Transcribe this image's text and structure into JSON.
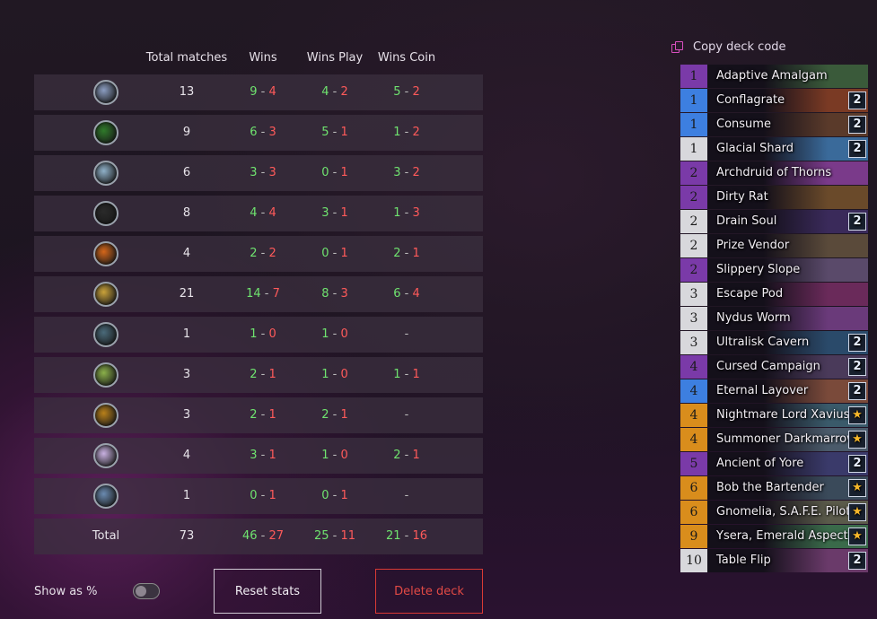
{
  "stats": {
    "headers": {
      "total": "Total matches",
      "wins": "Wins",
      "wins_play": "Wins Play",
      "wins_coin": "Wins Coin"
    },
    "rows": [
      {
        "icon": "rogue-class-icon",
        "total": "13",
        "wins_w": "9",
        "wins_l": "4",
        "play_w": "4",
        "play_l": "2",
        "coin_w": "5",
        "coin_l": "2"
      },
      {
        "icon": "demon-hunter-class-icon",
        "total": "9",
        "wins_w": "6",
        "wins_l": "3",
        "play_w": "5",
        "play_l": "1",
        "coin_w": "1",
        "coin_l": "2"
      },
      {
        "icon": "mage-class-icon",
        "total": "6",
        "wins_w": "3",
        "wins_l": "3",
        "play_w": "0",
        "play_l": "1",
        "coin_w": "3",
        "coin_l": "2"
      },
      {
        "icon": "death-knight-class-icon",
        "total": "8",
        "wins_w": "4",
        "wins_l": "4",
        "play_w": "3",
        "play_l": "1",
        "coin_w": "1",
        "coin_l": "3"
      },
      {
        "icon": "warrior-class-icon",
        "total": "4",
        "wins_w": "2",
        "wins_l": "2",
        "play_w": "0",
        "play_l": "1",
        "coin_w": "2",
        "coin_l": "1"
      },
      {
        "icon": "paladin-class-icon",
        "total": "21",
        "wins_w": "14",
        "wins_l": "7",
        "play_w": "8",
        "play_l": "3",
        "coin_w": "6",
        "coin_l": "4"
      },
      {
        "icon": "shaman-class-icon",
        "total": "1",
        "wins_w": "1",
        "wins_l": "0",
        "play_w": "1",
        "play_l": "0",
        "coin": "-"
      },
      {
        "icon": "hunter-class-icon",
        "total": "3",
        "wins_w": "2",
        "wins_l": "1",
        "play_w": "1",
        "play_l": "0",
        "coin_w": "1",
        "coin_l": "1"
      },
      {
        "icon": "druid-class-icon",
        "total": "3",
        "wins_w": "2",
        "wins_l": "1",
        "play_w": "2",
        "play_l": "1",
        "coin": "-"
      },
      {
        "icon": "priest-class-icon",
        "total": "4",
        "wins_w": "3",
        "wins_l": "1",
        "play_w": "1",
        "play_l": "0",
        "coin_w": "2",
        "coin_l": "1"
      },
      {
        "icon": "warlock-class-icon",
        "total": "1",
        "wins_w": "0",
        "wins_l": "1",
        "play_w": "0",
        "play_l": "1",
        "coin": "-"
      }
    ],
    "total_row": {
      "label": "Total",
      "total": "73",
      "wins_w": "46",
      "wins_l": "27",
      "play_w": "25",
      "play_l": "11",
      "coin_w": "21",
      "coin_l": "16"
    },
    "separator": "-"
  },
  "controls": {
    "show_pct_label": "Show as %",
    "reset_label": "Reset stats",
    "delete_label": "Delete deck"
  },
  "deck": {
    "copy_label": "Copy deck code",
    "cards": [
      {
        "cost": "1",
        "name": "Adaptive Amalgam",
        "count": "",
        "rarity": "epic",
        "art": "#3a5a3a"
      },
      {
        "cost": "1",
        "name": "Conflagrate",
        "count": "2",
        "rarity": "rare",
        "art": "#7a3a24"
      },
      {
        "cost": "1",
        "name": "Consume",
        "count": "2",
        "rarity": "rare",
        "art": "#5a3a2a"
      },
      {
        "cost": "1",
        "name": "Glacial Shard",
        "count": "2",
        "rarity": "common",
        "art": "#3a6a9a"
      },
      {
        "cost": "2",
        "name": "Archdruid of Thorns",
        "count": "",
        "rarity": "epic",
        "art": "#7a3a8a"
      },
      {
        "cost": "2",
        "name": "Dirty Rat",
        "count": "",
        "rarity": "epic",
        "art": "#6a4a2a"
      },
      {
        "cost": "2",
        "name": "Drain Soul",
        "count": "2",
        "rarity": "common",
        "art": "#3a2a5a"
      },
      {
        "cost": "2",
        "name": "Prize Vendor",
        "count": "",
        "rarity": "common",
        "art": "#5a4a3a"
      },
      {
        "cost": "2",
        "name": "Slippery Slope",
        "count": "",
        "rarity": "epic",
        "art": "#5a4a6a"
      },
      {
        "cost": "3",
        "name": "Escape Pod",
        "count": "",
        "rarity": "common",
        "art": "#6a2a5a"
      },
      {
        "cost": "3",
        "name": "Nydus Worm",
        "count": "",
        "rarity": "common",
        "art": "#6a3a7a"
      },
      {
        "cost": "3",
        "name": "Ultralisk Cavern",
        "count": "2",
        "rarity": "common",
        "art": "#2a4a6a"
      },
      {
        "cost": "4",
        "name": "Cursed Campaign",
        "count": "2",
        "rarity": "epic",
        "art": "#4a3a5a"
      },
      {
        "cost": "4",
        "name": "Eternal Layover",
        "count": "2",
        "rarity": "rare",
        "art": "#7a4a3a"
      },
      {
        "cost": "4",
        "name": "Nightmare Lord Xavius",
        "count": "★",
        "rarity": "legendary",
        "art": "#3a5a6a"
      },
      {
        "cost": "4",
        "name": "Summoner Darkmarrow",
        "count": "★",
        "rarity": "legendary",
        "art": "#4a5a6a"
      },
      {
        "cost": "5",
        "name": "Ancient of Yore",
        "count": "2",
        "rarity": "epic",
        "art": "#3a3a6a"
      },
      {
        "cost": "6",
        "name": "Bob the Bartender",
        "count": "★",
        "rarity": "legendary",
        "art": "#3a4a5a"
      },
      {
        "cost": "6",
        "name": "Gnomelia, S.A.F.E. Pilot",
        "count": "★",
        "rarity": "legendary",
        "art": "#5a5a4a"
      },
      {
        "cost": "9",
        "name": "Ysera, Emerald Aspect",
        "count": "★",
        "rarity": "legendary",
        "art": "#3a6a4a"
      },
      {
        "cost": "10",
        "name": "Table Flip",
        "count": "2",
        "rarity": "common",
        "art": "#6a3a6a"
      }
    ]
  },
  "colors": {
    "win": "#6fe36f",
    "loss": "#ff5a5a",
    "rarity_common": "#d8d8dc",
    "rarity_rare": "#3d7fe0",
    "rarity_epic": "#7a3aa8",
    "rarity_legendary": "#d98d1c",
    "delete": "#e34a45",
    "copy_icon": "#d94fbf"
  }
}
